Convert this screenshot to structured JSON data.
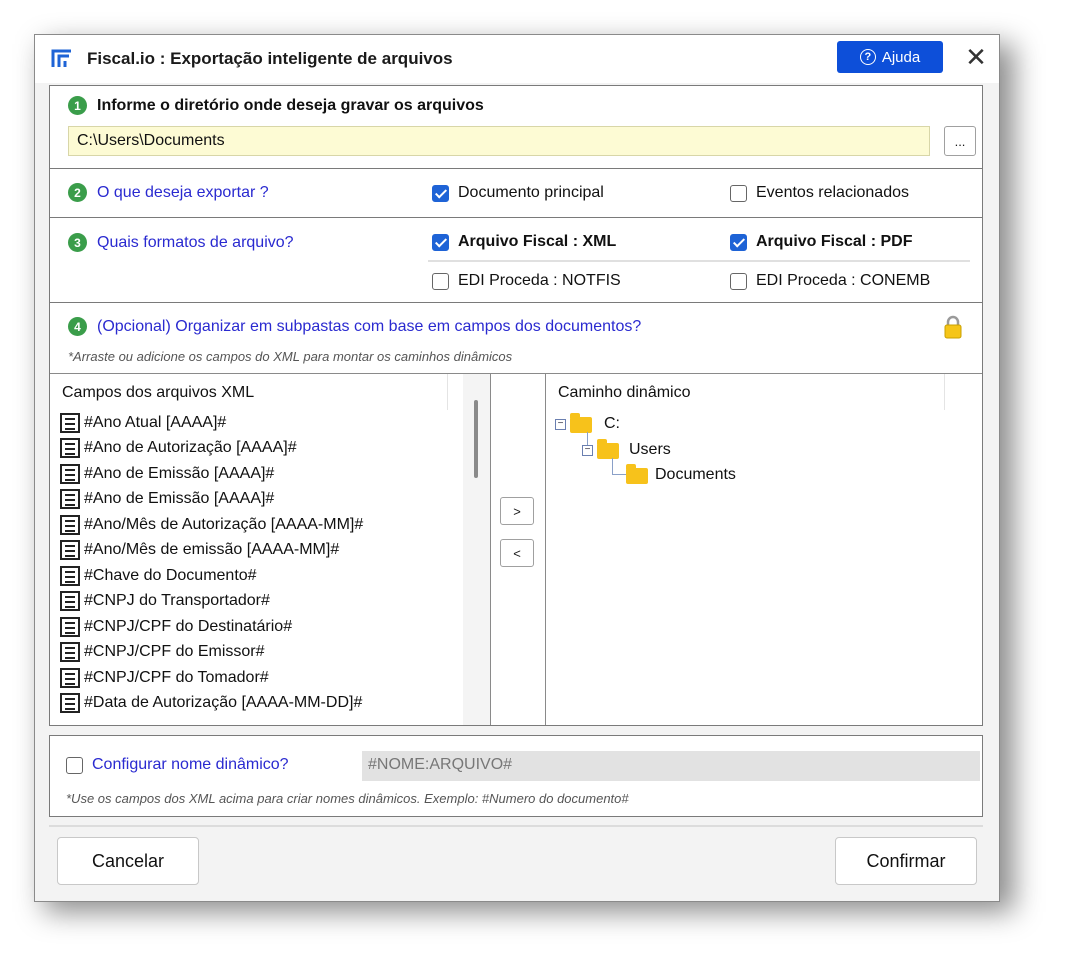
{
  "window": {
    "title": "Fiscal.io : Exportação inteligente de arquivos",
    "help_label": "Ajuda",
    "close_glyph": "✕"
  },
  "step1": {
    "number": "1",
    "label": "Informe o diretório onde deseja gravar os arquivos",
    "path_value": "C:\\Users\\Documents",
    "browse_label": "..."
  },
  "step2": {
    "number": "2",
    "label": "O que deseja exportar ?",
    "options": [
      {
        "label": "Documento principal",
        "checked": true
      },
      {
        "label": "Eventos relacionados",
        "checked": false
      }
    ]
  },
  "step3": {
    "number": "3",
    "label": "Quais formatos de arquivo?",
    "options": [
      {
        "label": "Arquivo Fiscal : XML",
        "checked": true
      },
      {
        "label": "Arquivo Fiscal : PDF",
        "checked": true
      },
      {
        "label": "EDI Proceda : NOTFIS",
        "checked": false
      },
      {
        "label": "EDI Proceda : CONEMB",
        "checked": false
      }
    ]
  },
  "step4": {
    "number": "4",
    "label": "(Opcional) Organizar em subpastas com base em campos dos documentos?",
    "hint": "*Arraste ou adicione os campos do XML para montar os caminhos dinâmicos",
    "fields_header": "Campos dos arquivos XML",
    "fields": [
      "#Ano Atual [AAAA]#",
      "#Ano de Autorização [AAAA]#",
      "#Ano de Emissão [AAAA]#",
      "#Ano de Emissão [AAAA]#",
      "#Ano/Mês de Autorização [AAAA-MM]#",
      "#Ano/Mês de emissão [AAAA-MM]#",
      "#Chave do Documento#",
      "#CNPJ do Transportador#",
      "#CNPJ/CPF do Destinatário#",
      "#CNPJ/CPF do Emissor#",
      "#CNPJ/CPF do Tomador#",
      "#Data de Autorização [AAAA-MM-DD]#"
    ],
    "add_label": ">",
    "remove_label": "<",
    "path_header": "Caminho dinâmico",
    "tree": [
      "C:",
      "Users",
      "Documents"
    ]
  },
  "dynamic_name": {
    "label": "Configurar nome dinâmico?",
    "checked": false,
    "placeholder": "#NOME:ARQUIVO#",
    "hint": "*Use os campos dos XML acima para criar nomes dinâmicos. Exemplo: #Numero do documento#"
  },
  "footer": {
    "cancel_label": "Cancelar",
    "confirm_label": "Confirmar"
  },
  "colors": {
    "accent": "#0d4fd9",
    "step_badge": "#3a9d4a",
    "question_text": "#2a2ad0",
    "folder": "#f7c21b",
    "path_field": "#fdfbd4"
  }
}
